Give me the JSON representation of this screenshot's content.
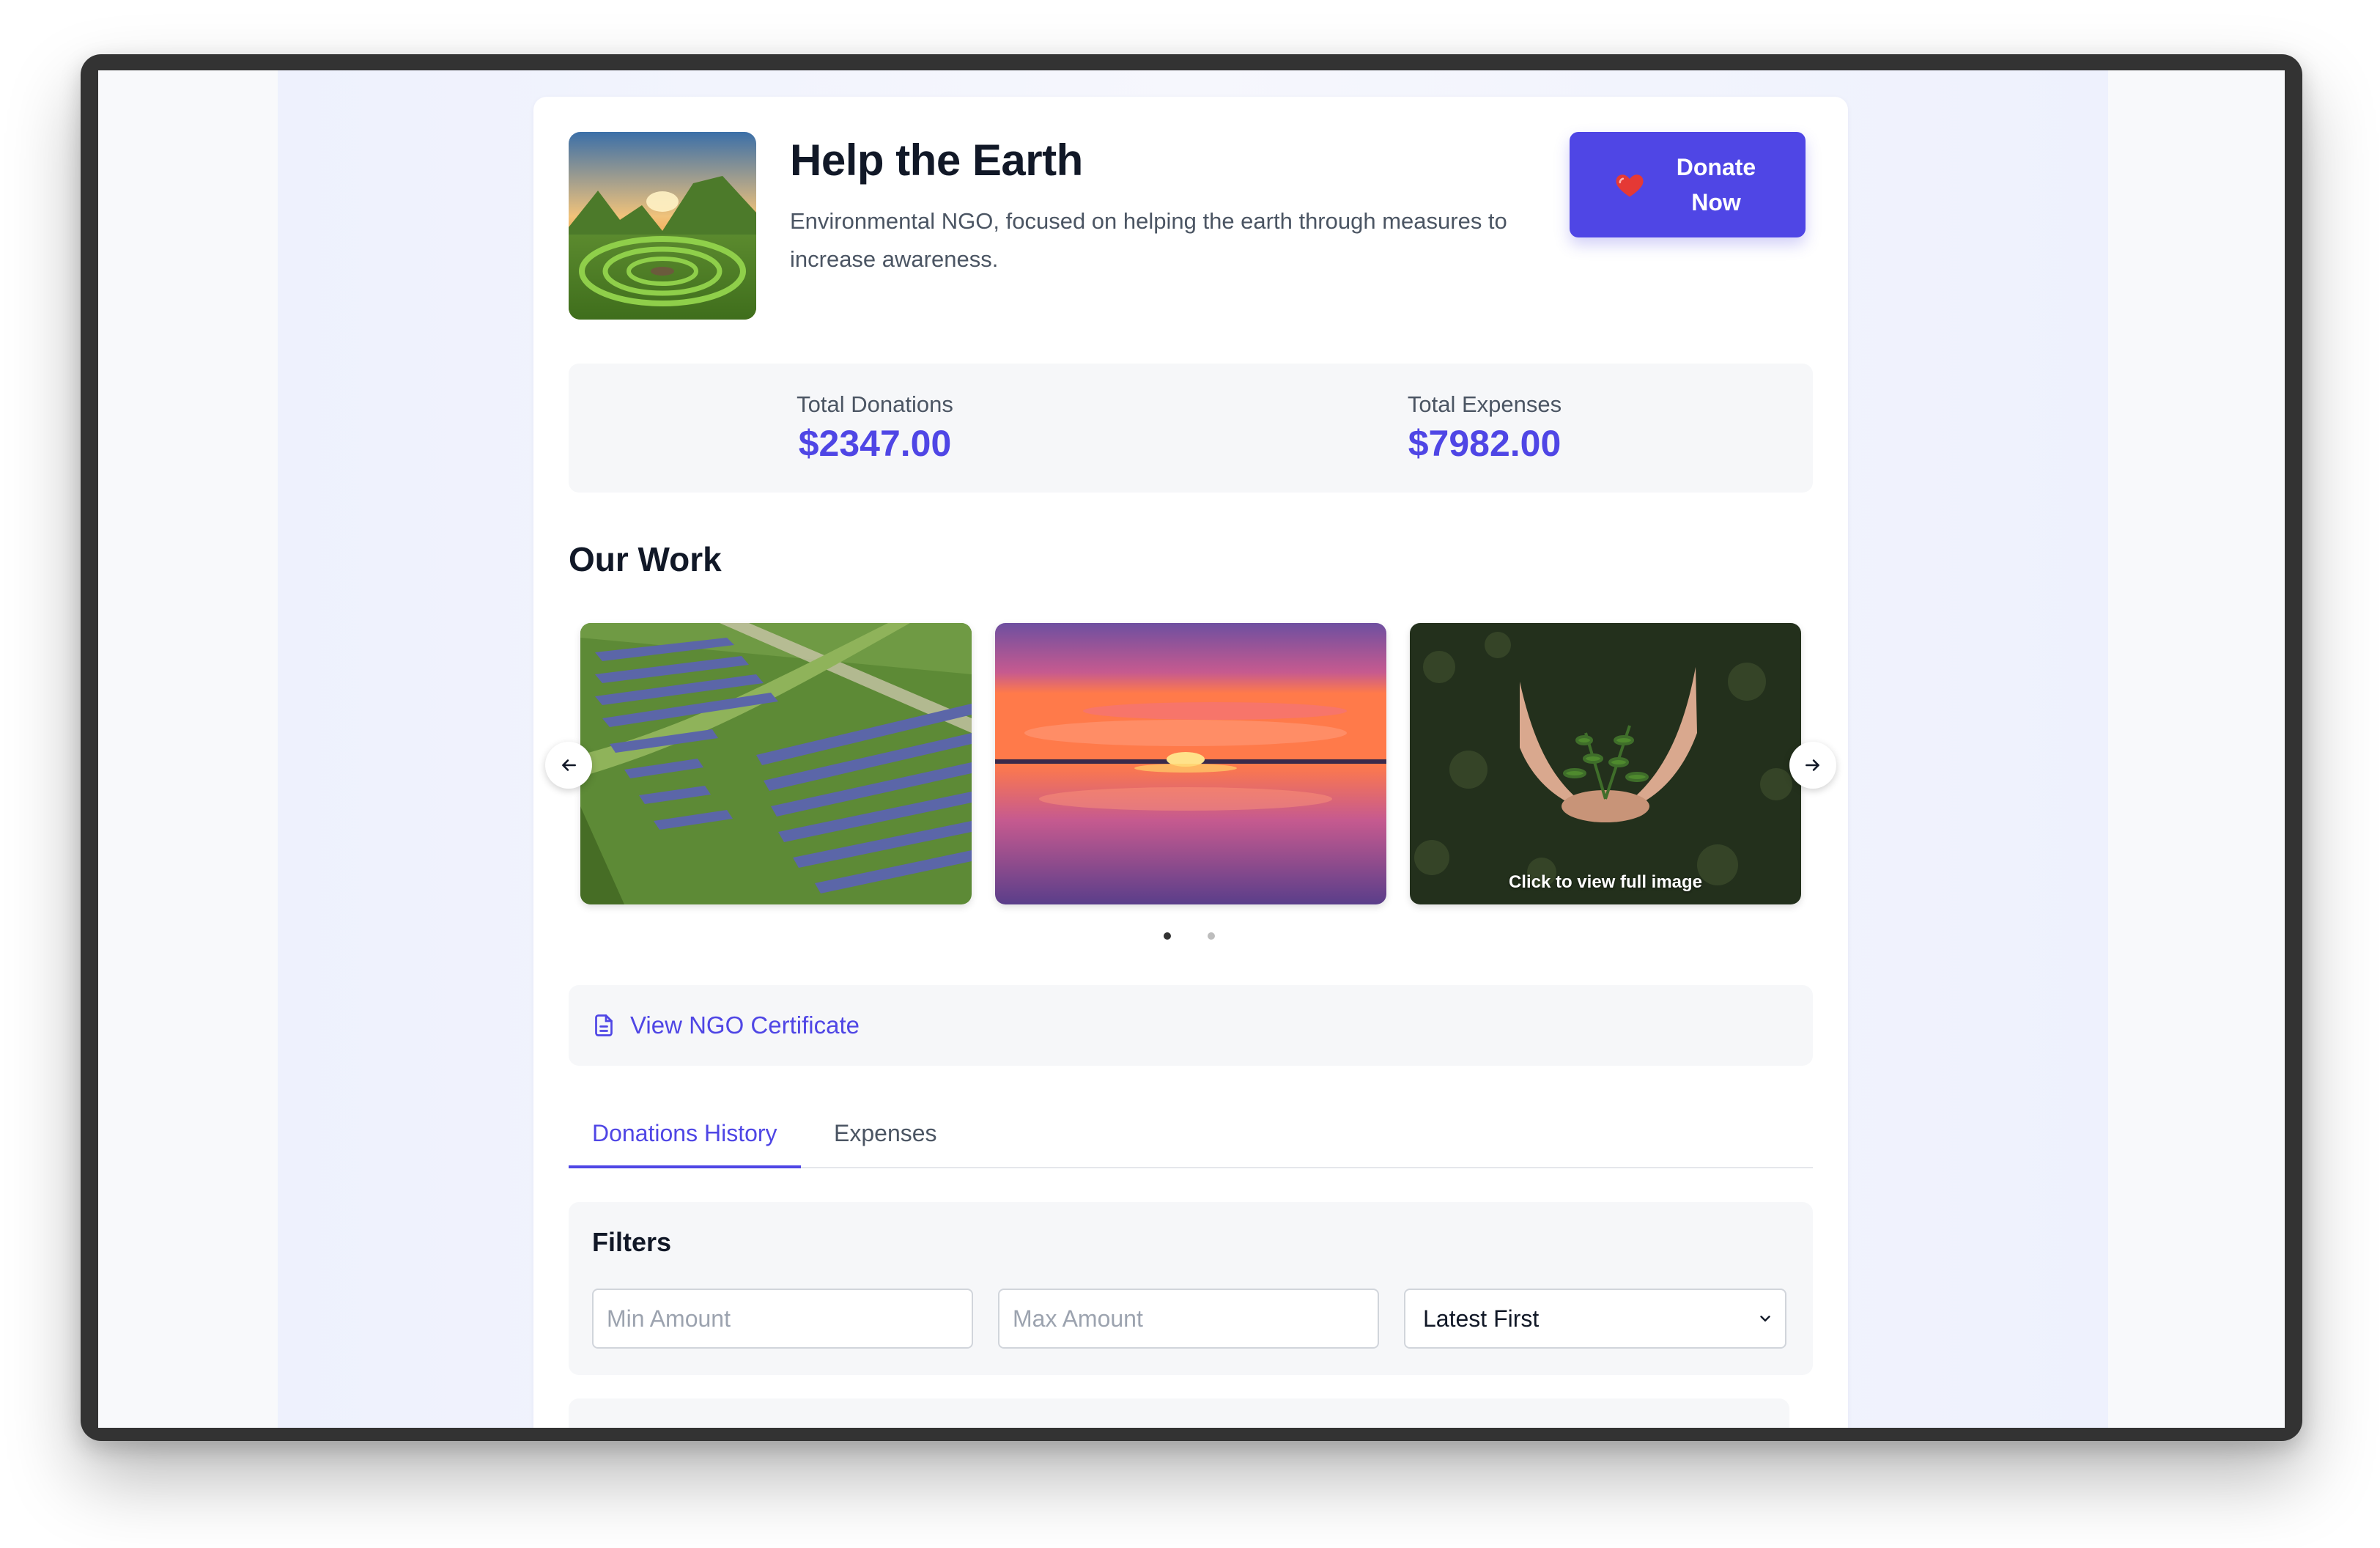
{
  "org": {
    "name": "Help the Earth",
    "description": "Environmental NGO, focused on helping the earth through measures to increase awareness."
  },
  "donate_button": {
    "label": "Donate Now",
    "icon": "heart-icon"
  },
  "stats": {
    "donations_label": "Total Donations",
    "donations_value": "$2347.00",
    "expenses_label": "Total Expenses",
    "expenses_value": "$7982.00"
  },
  "our_work": {
    "title": "Our Work",
    "images": [
      {
        "subject": "solar-farm-aerial"
      },
      {
        "subject": "sunset-over-water"
      },
      {
        "subject": "hands-holding-seedling",
        "caption": "Click to view full image"
      }
    ],
    "page_count": 2,
    "active_page": 1
  },
  "certificate": {
    "label": "View NGO Certificate",
    "icon": "document-icon"
  },
  "tabs": [
    {
      "label": "Donations History",
      "active": true
    },
    {
      "label": "Expenses",
      "active": false
    }
  ],
  "filters": {
    "title": "Filters",
    "min_placeholder": "Min Amount",
    "max_placeholder": "Max Amount",
    "sort_value": "Latest First"
  },
  "colors": {
    "accent": "#4f46e5",
    "heading": "#111827",
    "muted_text": "#4b5563",
    "panel_bg": "#f6f7f9"
  }
}
